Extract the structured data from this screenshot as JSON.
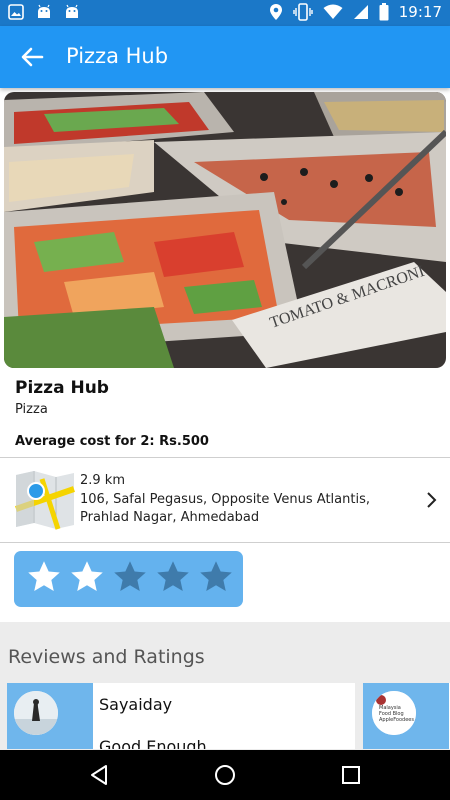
{
  "status_bar": {
    "time": "19:17",
    "left_icons": [
      "image-icon",
      "android-icon",
      "android-icon"
    ],
    "right_icons": [
      "location-icon",
      "vibrate-icon",
      "wifi-icon",
      "signal-icon",
      "battery-icon"
    ]
  },
  "app_bar": {
    "title": "Pizza Hub",
    "back_icon": "arrow-back-icon",
    "color": "#2196f3"
  },
  "restaurant": {
    "name": "Pizza Hub",
    "cuisine": "Pizza",
    "cost": "Average cost for 2: Rs.500",
    "hero_sign": "TOMATO & MACRONI"
  },
  "location": {
    "distance": "2.9 km",
    "address": "106, Safal Pegasus, Opposite Venus Atlantis, Prahlad Nagar, Ahmedabad"
  },
  "rating": {
    "value": 2,
    "max": 5
  },
  "reviews": {
    "title": "Reviews and Ratings",
    "items": [
      {
        "name": "Sayaiday",
        "text": "Good Enough"
      },
      {
        "avatar_text": "Malaysia Food Blog AppleFoodees"
      }
    ]
  },
  "nav_bar": {
    "buttons": [
      "back-triangle-icon",
      "home-circle-icon",
      "recents-square-icon"
    ]
  }
}
